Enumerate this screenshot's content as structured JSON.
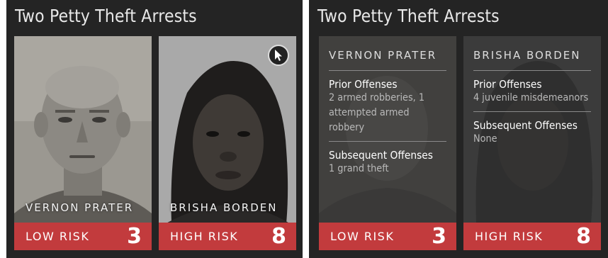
{
  "left_panel": {
    "title": "Two Petty Theft Arrests",
    "cards": [
      {
        "name": "VERNON PRATER",
        "risk_label": "LOW RISK",
        "risk_score": "3"
      },
      {
        "name": "BRISHA BORDEN",
        "risk_label": "HIGH RISK",
        "risk_score": "8"
      }
    ],
    "cursor_icon": "pointer-cursor-icon"
  },
  "right_panel": {
    "title": "Two Petty Theft Arrests",
    "cards": [
      {
        "name": "VERNON PRATER",
        "prior_heading": "Prior Offenses",
        "prior_text": "2 armed robberies, 1 attempted armed robbery",
        "subsequent_heading": "Subsequent Offenses",
        "subsequent_text": "1 grand theft",
        "risk_label": "LOW RISK",
        "risk_score": "3"
      },
      {
        "name": "BRISHA BORDEN",
        "prior_heading": "Prior Offenses",
        "prior_text": "4 juvenile misdemeanors",
        "subsequent_heading": "Subsequent Offenses",
        "subsequent_text": "None",
        "risk_label": "HIGH RISK",
        "risk_score": "8"
      }
    ]
  },
  "colors": {
    "panel_bg": "#242424",
    "risk_red": "#c23b3d"
  }
}
